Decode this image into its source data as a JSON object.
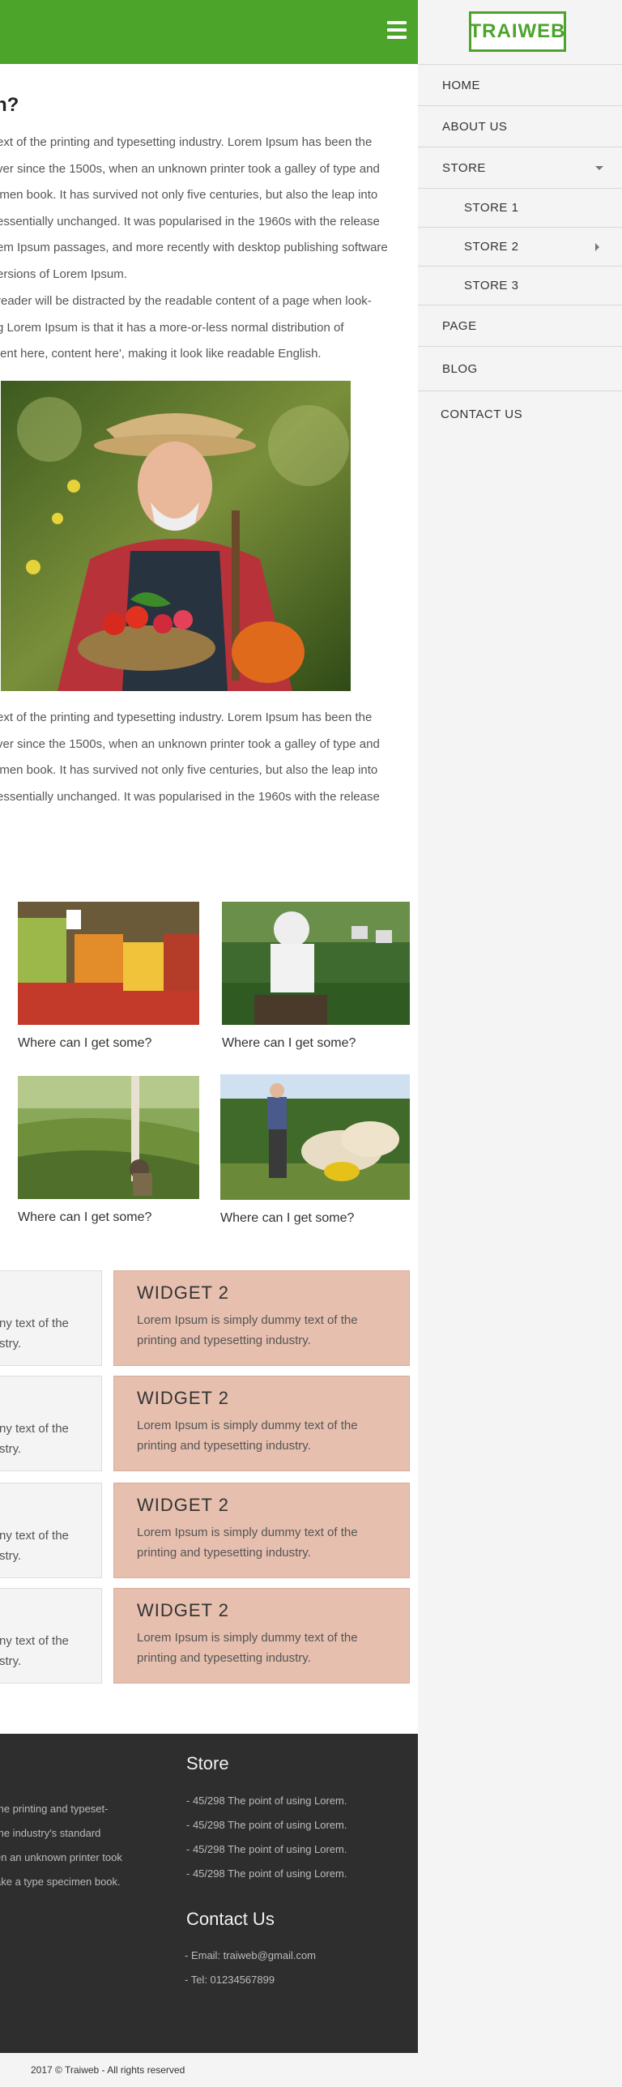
{
  "header": {
    "menu_icon": "hamburger-icon"
  },
  "brand": {
    "logo_text": "TRAIWEB",
    "accent": "#4ca42b"
  },
  "article": {
    "title": "n?",
    "para1": [
      "ext of the printing and typesetting industry. Lorem Ipsum has been the",
      "ver since the 1500s, when an unknown printer took a galley of type and",
      "imen book. It has survived not only five centuries, but also the leap into",
      "essentially unchanged. It was popularised in the 1960s with the release",
      "em Ipsum passages, and more recently with desktop publishing software",
      "ersions of Lorem Ipsum."
    ],
    "para2": [
      " reader will be distracted by the readable content of a page when look-",
      "g Lorem Ipsum is that it has a more-or-less normal distribution of",
      "tent here, content here', making it look like readable English."
    ],
    "para3": [
      "ext of the printing and typesetting industry. Lorem Ipsum has been the",
      "ver since the 1500s, when an unknown printer took a galley of type and",
      "imen book. It has survived not only five centuries, but also the leap into",
      "essentially unchanged. It was popularised in the 1960s with the release"
    ]
  },
  "gallery": [
    {
      "caption": "Where can I get some?"
    },
    {
      "caption": "Where can I get some?"
    },
    {
      "caption": "Where can I get some?"
    },
    {
      "caption": "Where can I get some?"
    }
  ],
  "widgets": [
    {
      "left_text": [
        "ny text of the",
        "stry."
      ],
      "title": "WIDGET 2",
      "text": "Lorem Ipsum is simply dummy text of the printing and typesetting industry."
    },
    {
      "left_text": [
        "ny text of the",
        "stry."
      ],
      "title": "WIDGET 2",
      "text": "Lorem Ipsum is simply dummy text of the printing and typesetting industry."
    },
    {
      "left_text": [
        "ny text of the",
        "stry."
      ],
      "title": "WIDGET 2",
      "text": "Lorem Ipsum is simply dummy text of the printing and typesetting industry."
    },
    {
      "left_text": [
        "ny text of the",
        "stry."
      ],
      "title": "WIDGET 2",
      "text": "Lorem Ipsum is simply dummy text of the printing and typesetting industry."
    }
  ],
  "footer": {
    "about_lines": [
      " the printing and typeset-",
      "the industry's standard",
      "en an unknown printer took",
      "ake a type specimen book."
    ],
    "store_title": "Store",
    "store_items": [
      "- 45/298 The point of using Lorem.",
      "- 45/298 The point of using Lorem.",
      "- 45/298 The point of using Lorem.",
      "- 45/298 The point of using Lorem."
    ],
    "contact_title": "Contact Us",
    "contact_items": [
      "- Email: traiweb@gmail.com",
      "- Tel: 01234567899"
    ],
    "copyright": "2017 © Traiweb - All rights reserved"
  },
  "menu": {
    "items": [
      {
        "label": "HOME"
      },
      {
        "label": "ABOUT US"
      },
      {
        "label": "STORE"
      },
      {
        "label": "STORE 1"
      },
      {
        "label": "STORE 2"
      },
      {
        "label": "STORE 3"
      },
      {
        "label": "PAGE"
      },
      {
        "label": "BLOG"
      },
      {
        "label": "CONTACT US"
      }
    ]
  }
}
